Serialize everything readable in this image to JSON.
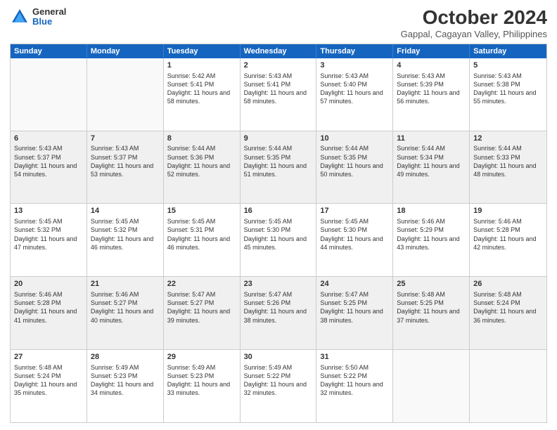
{
  "header": {
    "logo_general": "General",
    "logo_blue": "Blue",
    "title": "October 2024",
    "subtitle": "Gappal, Cagayan Valley, Philippines"
  },
  "weekdays": [
    "Sunday",
    "Monday",
    "Tuesday",
    "Wednesday",
    "Thursday",
    "Friday",
    "Saturday"
  ],
  "rows": [
    [
      {
        "day": "",
        "text": "",
        "empty": true
      },
      {
        "day": "",
        "text": "",
        "empty": true
      },
      {
        "day": "1",
        "text": "Sunrise: 5:42 AM\nSunset: 5:41 PM\nDaylight: 11 hours and 58 minutes."
      },
      {
        "day": "2",
        "text": "Sunrise: 5:43 AM\nSunset: 5:41 PM\nDaylight: 11 hours and 58 minutes."
      },
      {
        "day": "3",
        "text": "Sunrise: 5:43 AM\nSunset: 5:40 PM\nDaylight: 11 hours and 57 minutes."
      },
      {
        "day": "4",
        "text": "Sunrise: 5:43 AM\nSunset: 5:39 PM\nDaylight: 11 hours and 56 minutes."
      },
      {
        "day": "5",
        "text": "Sunrise: 5:43 AM\nSunset: 5:38 PM\nDaylight: 11 hours and 55 minutes."
      }
    ],
    [
      {
        "day": "6",
        "text": "Sunrise: 5:43 AM\nSunset: 5:37 PM\nDaylight: 11 hours and 54 minutes."
      },
      {
        "day": "7",
        "text": "Sunrise: 5:43 AM\nSunset: 5:37 PM\nDaylight: 11 hours and 53 minutes."
      },
      {
        "day": "8",
        "text": "Sunrise: 5:44 AM\nSunset: 5:36 PM\nDaylight: 11 hours and 52 minutes."
      },
      {
        "day": "9",
        "text": "Sunrise: 5:44 AM\nSunset: 5:35 PM\nDaylight: 11 hours and 51 minutes."
      },
      {
        "day": "10",
        "text": "Sunrise: 5:44 AM\nSunset: 5:35 PM\nDaylight: 11 hours and 50 minutes."
      },
      {
        "day": "11",
        "text": "Sunrise: 5:44 AM\nSunset: 5:34 PM\nDaylight: 11 hours and 49 minutes."
      },
      {
        "day": "12",
        "text": "Sunrise: 5:44 AM\nSunset: 5:33 PM\nDaylight: 11 hours and 48 minutes."
      }
    ],
    [
      {
        "day": "13",
        "text": "Sunrise: 5:45 AM\nSunset: 5:32 PM\nDaylight: 11 hours and 47 minutes."
      },
      {
        "day": "14",
        "text": "Sunrise: 5:45 AM\nSunset: 5:32 PM\nDaylight: 11 hours and 46 minutes."
      },
      {
        "day": "15",
        "text": "Sunrise: 5:45 AM\nSunset: 5:31 PM\nDaylight: 11 hours and 46 minutes."
      },
      {
        "day": "16",
        "text": "Sunrise: 5:45 AM\nSunset: 5:30 PM\nDaylight: 11 hours and 45 minutes."
      },
      {
        "day": "17",
        "text": "Sunrise: 5:45 AM\nSunset: 5:30 PM\nDaylight: 11 hours and 44 minutes."
      },
      {
        "day": "18",
        "text": "Sunrise: 5:46 AM\nSunset: 5:29 PM\nDaylight: 11 hours and 43 minutes."
      },
      {
        "day": "19",
        "text": "Sunrise: 5:46 AM\nSunset: 5:28 PM\nDaylight: 11 hours and 42 minutes."
      }
    ],
    [
      {
        "day": "20",
        "text": "Sunrise: 5:46 AM\nSunset: 5:28 PM\nDaylight: 11 hours and 41 minutes."
      },
      {
        "day": "21",
        "text": "Sunrise: 5:46 AM\nSunset: 5:27 PM\nDaylight: 11 hours and 40 minutes."
      },
      {
        "day": "22",
        "text": "Sunrise: 5:47 AM\nSunset: 5:27 PM\nDaylight: 11 hours and 39 minutes."
      },
      {
        "day": "23",
        "text": "Sunrise: 5:47 AM\nSunset: 5:26 PM\nDaylight: 11 hours and 38 minutes."
      },
      {
        "day": "24",
        "text": "Sunrise: 5:47 AM\nSunset: 5:25 PM\nDaylight: 11 hours and 38 minutes."
      },
      {
        "day": "25",
        "text": "Sunrise: 5:48 AM\nSunset: 5:25 PM\nDaylight: 11 hours and 37 minutes."
      },
      {
        "day": "26",
        "text": "Sunrise: 5:48 AM\nSunset: 5:24 PM\nDaylight: 11 hours and 36 minutes."
      }
    ],
    [
      {
        "day": "27",
        "text": "Sunrise: 5:48 AM\nSunset: 5:24 PM\nDaylight: 11 hours and 35 minutes."
      },
      {
        "day": "28",
        "text": "Sunrise: 5:49 AM\nSunset: 5:23 PM\nDaylight: 11 hours and 34 minutes."
      },
      {
        "day": "29",
        "text": "Sunrise: 5:49 AM\nSunset: 5:23 PM\nDaylight: 11 hours and 33 minutes."
      },
      {
        "day": "30",
        "text": "Sunrise: 5:49 AM\nSunset: 5:22 PM\nDaylight: 11 hours and 32 minutes."
      },
      {
        "day": "31",
        "text": "Sunrise: 5:50 AM\nSunset: 5:22 PM\nDaylight: 11 hours and 32 minutes."
      },
      {
        "day": "",
        "text": "",
        "empty": true
      },
      {
        "day": "",
        "text": "",
        "empty": true
      }
    ]
  ]
}
